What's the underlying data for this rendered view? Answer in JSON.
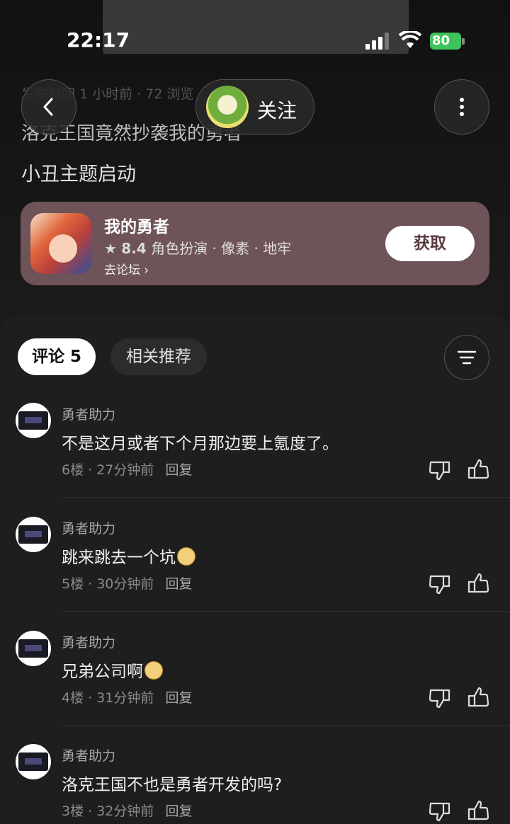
{
  "status_bar": {
    "time": "22:17",
    "battery": "80"
  },
  "header": {
    "follow_label": "关注",
    "meta": "发布时间 1 小时前 · 72 浏览"
  },
  "post": {
    "title": "洛克王国竟然抄袭我的勇者",
    "body": "小丑主题启动"
  },
  "game_card": {
    "name": "我的勇者",
    "rating": "8.4",
    "tags": "角色扮演 · 像素 · 地牢",
    "forum_link": "去论坛",
    "get_label": "获取",
    "card_color": "#6e5358"
  },
  "tabs": {
    "comments": "评论 5",
    "related": "相关推荐"
  },
  "comments": [
    {
      "user": "勇者助力",
      "text": "不是这月或者下个月那边要上氪度了。",
      "floor": "6楼",
      "time": "27分钟前",
      "reply": "回复"
    },
    {
      "user": "勇者助力",
      "text": "跳来跳去一个坑",
      "floor": "5楼",
      "time": "30分钟前",
      "reply": "回复"
    },
    {
      "user": "勇者助力",
      "text": "兄弟公司啊",
      "floor": "4楼",
      "time": "31分钟前",
      "reply": "回复"
    },
    {
      "user": "勇者助力",
      "text": "洛克王国不也是勇者开发的吗?",
      "floor": "3楼",
      "time": "32分钟前",
      "reply": "回复"
    }
  ],
  "icons": {
    "back": "chevron-left-icon",
    "more": "more-vertical-icon",
    "sort": "sort-lines-icon",
    "dislike": "thumbs-down-icon",
    "like": "thumbs-up-icon"
  }
}
